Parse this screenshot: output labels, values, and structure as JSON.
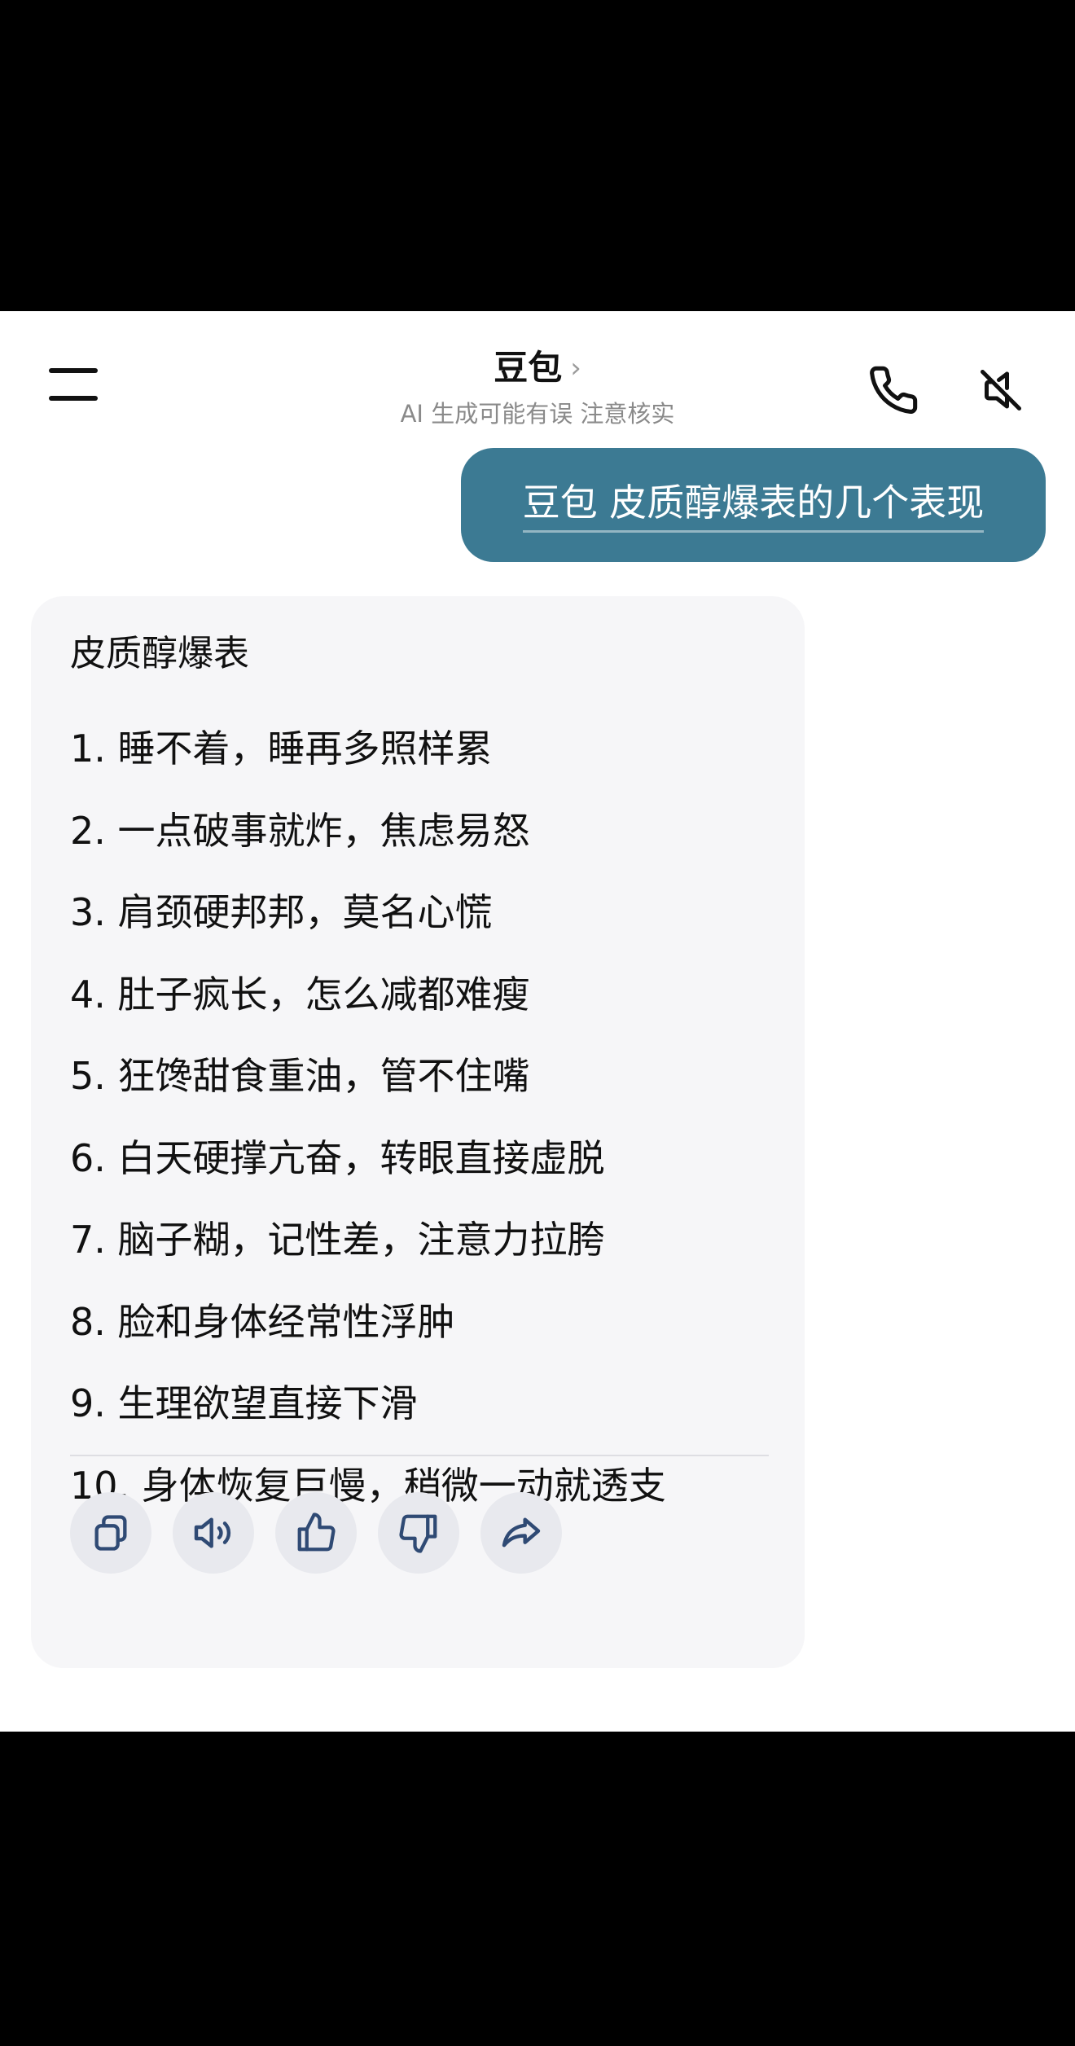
{
  "header": {
    "title": "豆包",
    "title_chevron": "›",
    "subtitle": "AI 生成可能有误 注意核实"
  },
  "user_message": {
    "text": "豆包 皮质醇爆表的几个表现",
    "bubble_color": "#3c7a93"
  },
  "ai_message": {
    "heading": "皮质醇爆表",
    "items": [
      "1. 睡不着，睡再多照样累",
      "2. 一点破事就炸，焦虑易怒",
      "3. 肩颈硬邦邦，莫名心慌",
      "4. 肚子疯长，怎么减都难瘦",
      "5. 狂馋甜食重油，管不住嘴",
      "6. 白天硬撑亢奋，转眼直接虚脱",
      "7. 脑子糊，记性差，注意力拉胯",
      "8. 脸和身体经常性浮肿",
      "9. 生理欲望直接下滑",
      "10. 身体恢复巨慢，稍微一动就透支"
    ],
    "actions": [
      {
        "icon": "copy-icon"
      },
      {
        "icon": "speaker-icon"
      },
      {
        "icon": "thumbs-up-icon"
      },
      {
        "icon": "thumbs-down-icon"
      },
      {
        "icon": "share-icon"
      }
    ],
    "icon_color": "#2f4a74"
  },
  "header_icons": [
    "menu-icon",
    "phone-icon",
    "speaker-muted-icon"
  ]
}
